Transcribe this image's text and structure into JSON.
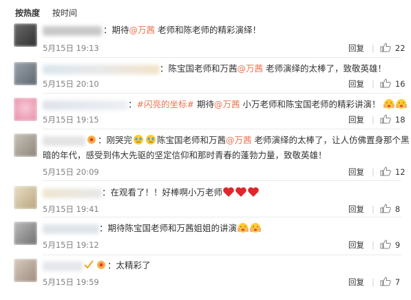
{
  "sort": {
    "hot": "按热度",
    "time": "按时间"
  },
  "reply_label": "回复",
  "colors": {
    "mention": "#eb7350",
    "time": "#808080"
  },
  "comments": [
    {
      "prefix": "：期待",
      "mention": "@万茜",
      "rest": " 老师和陈老师的精彩演绎！",
      "time": "5月15日 19:13",
      "likes": "22"
    },
    {
      "prefix": "：陈宝国老师和万茜",
      "mention": "@万茜",
      "rest": " 老师演绎的太棒了，致敬英雄！",
      "time": "5月15日 20:10",
      "likes": "16"
    },
    {
      "prefix": "：",
      "topic": "#闪亮的坐标#",
      "mid": " 期待",
      "mention": "@万茜",
      "rest": " 小万老师和陈宝国老师的精彩讲演！",
      "time": "5月15日 19:15",
      "likes": "18"
    },
    {
      "prefix": "：刚哭完",
      "mid": "陈宝国老师和万茜",
      "mention": "@万茜",
      "rest": " 老师演绎的太棒了，让人仿佛置身那个黑",
      "line2": "暗的年代，感受到伟大先驱的坚定信仰和那时青春的蓬勃力量，致敬英雄！",
      "time": "5月15日 20:09",
      "likes": "12"
    },
    {
      "prefix": "：在观看了！！好棒啊小万老师",
      "time": "5月15日 19:41",
      "likes": "8"
    },
    {
      "prefix": "：期待陈宝国老师和万茜姐姐的讲演",
      "time": "5月15日 19:12",
      "likes": "9"
    },
    {
      "prefix": "：太精彩了",
      "time": "5月15日 19:59",
      "likes": "7"
    }
  ]
}
